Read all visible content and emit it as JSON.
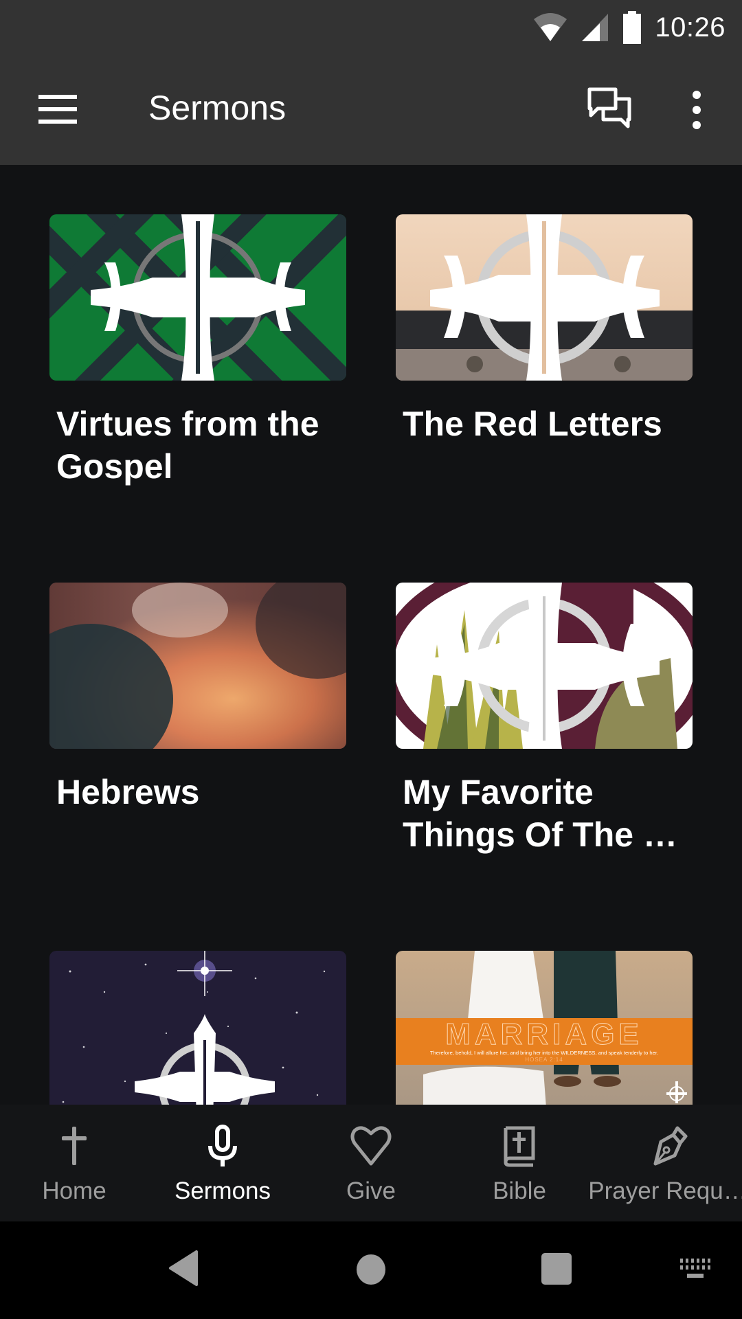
{
  "status_bar": {
    "time": "10:26",
    "icons": [
      "wifi-icon",
      "cell-signal-icon",
      "battery-icon"
    ]
  },
  "app_bar": {
    "title": "Sermons",
    "left_icon": "hamburger-menu-icon",
    "right_icons": [
      "chat-bubbles-icon",
      "more-vert-icon"
    ]
  },
  "sermon_series": [
    {
      "title": "Virtues from the Gospel",
      "image": "green-cross-artwork"
    },
    {
      "title": "The Red Letters",
      "image": "typewriter-cross-artwork"
    },
    {
      "title": "Hebrews",
      "image": "sunset-clouds-photo"
    },
    {
      "title": "My Favorite Things Of The …",
      "image": "plant-cross-artwork"
    },
    {
      "title": "",
      "image": "starry-night-cross-artwork"
    },
    {
      "title": "",
      "image": "marriage-wilderness-artwork",
      "image_text": {
        "headline": "MARRIAGE",
        "verse": "Therefore, behold, I will allure her, and bring her into the WILDERNESS, and speak tenderly to her.",
        "reference": "HOSEA 2:14"
      }
    }
  ],
  "bottom_nav": {
    "active": "Sermons",
    "items": [
      {
        "label": "Home",
        "icon": "cross-icon"
      },
      {
        "label": "Sermons",
        "icon": "microphone-icon"
      },
      {
        "label": "Give",
        "icon": "heart-icon"
      },
      {
        "label": "Bible",
        "icon": "bible-icon"
      },
      {
        "label": "Prayer Requ…",
        "icon": "pen-nib-icon"
      }
    ]
  },
  "system_nav": [
    "back",
    "home",
    "recents",
    "keyboard"
  ],
  "colors": {
    "app_bar": "#333333",
    "background": "#111214",
    "bottom_nav": "#141517",
    "inactive": "#9e9e9e",
    "active": "#ffffff",
    "marriage_orange": "#e8801f"
  }
}
